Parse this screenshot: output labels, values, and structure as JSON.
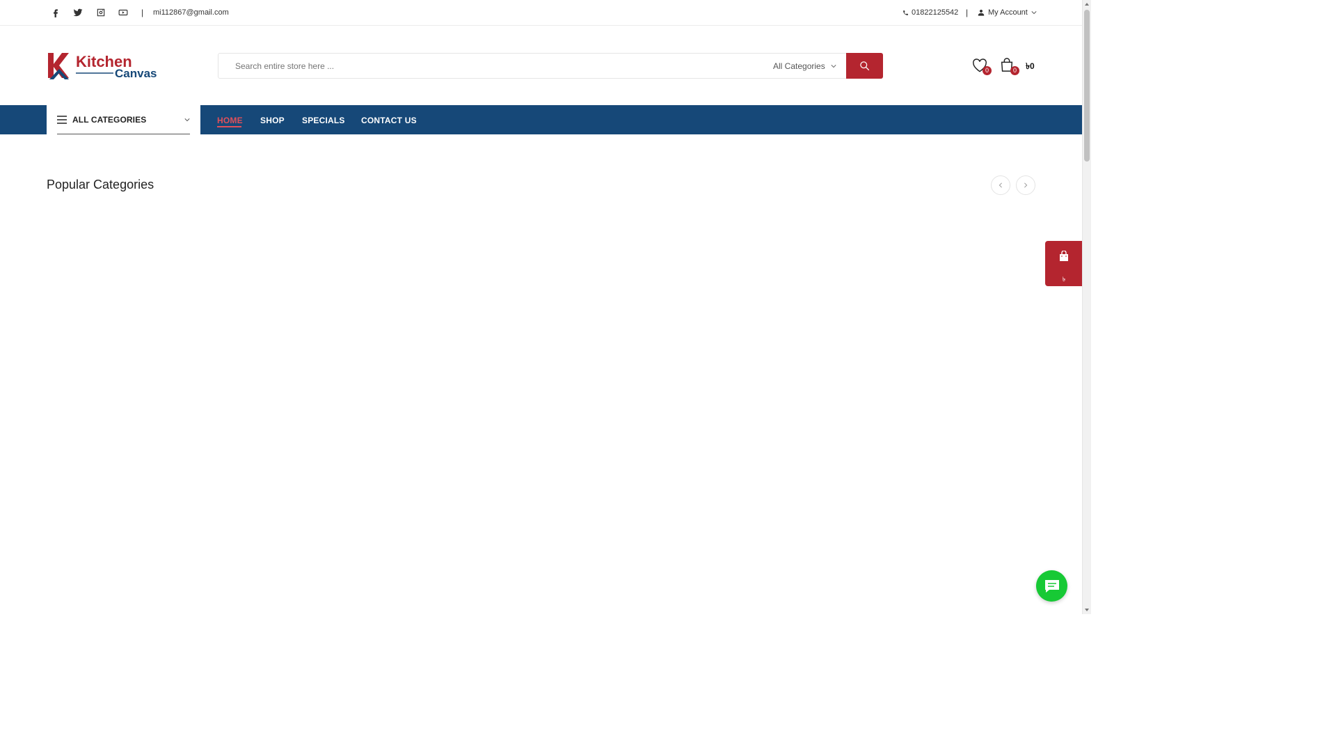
{
  "topbar": {
    "social": [
      "facebook-icon",
      "twitter-icon",
      "instagram-icon",
      "youtube-icon"
    ],
    "separator": "|",
    "email": "mi112867@gmail.com",
    "phone": "01822125542",
    "account_label": "My Account"
  },
  "header": {
    "logo": {
      "word1": "Kitchen",
      "word2": "Canvas"
    },
    "search": {
      "placeholder": "Search entire store here ...",
      "category": "All Categories"
    },
    "wishlist_count": "0",
    "cart_count": "0",
    "cart_total": "৳0"
  },
  "nav": {
    "all_categories": "ALL CATEGORIES",
    "items": [
      "HOME",
      "SHOP",
      "SPECIALS",
      "CONTACT US"
    ]
  },
  "content": {
    "section_title": "Popular Categories"
  },
  "floating_cart": {
    "total": "৳"
  },
  "colors": {
    "brand_red": "#b4252f",
    "nav_blue": "#164878",
    "active_nav": "#e0505a",
    "chat_green": "#17c935"
  }
}
